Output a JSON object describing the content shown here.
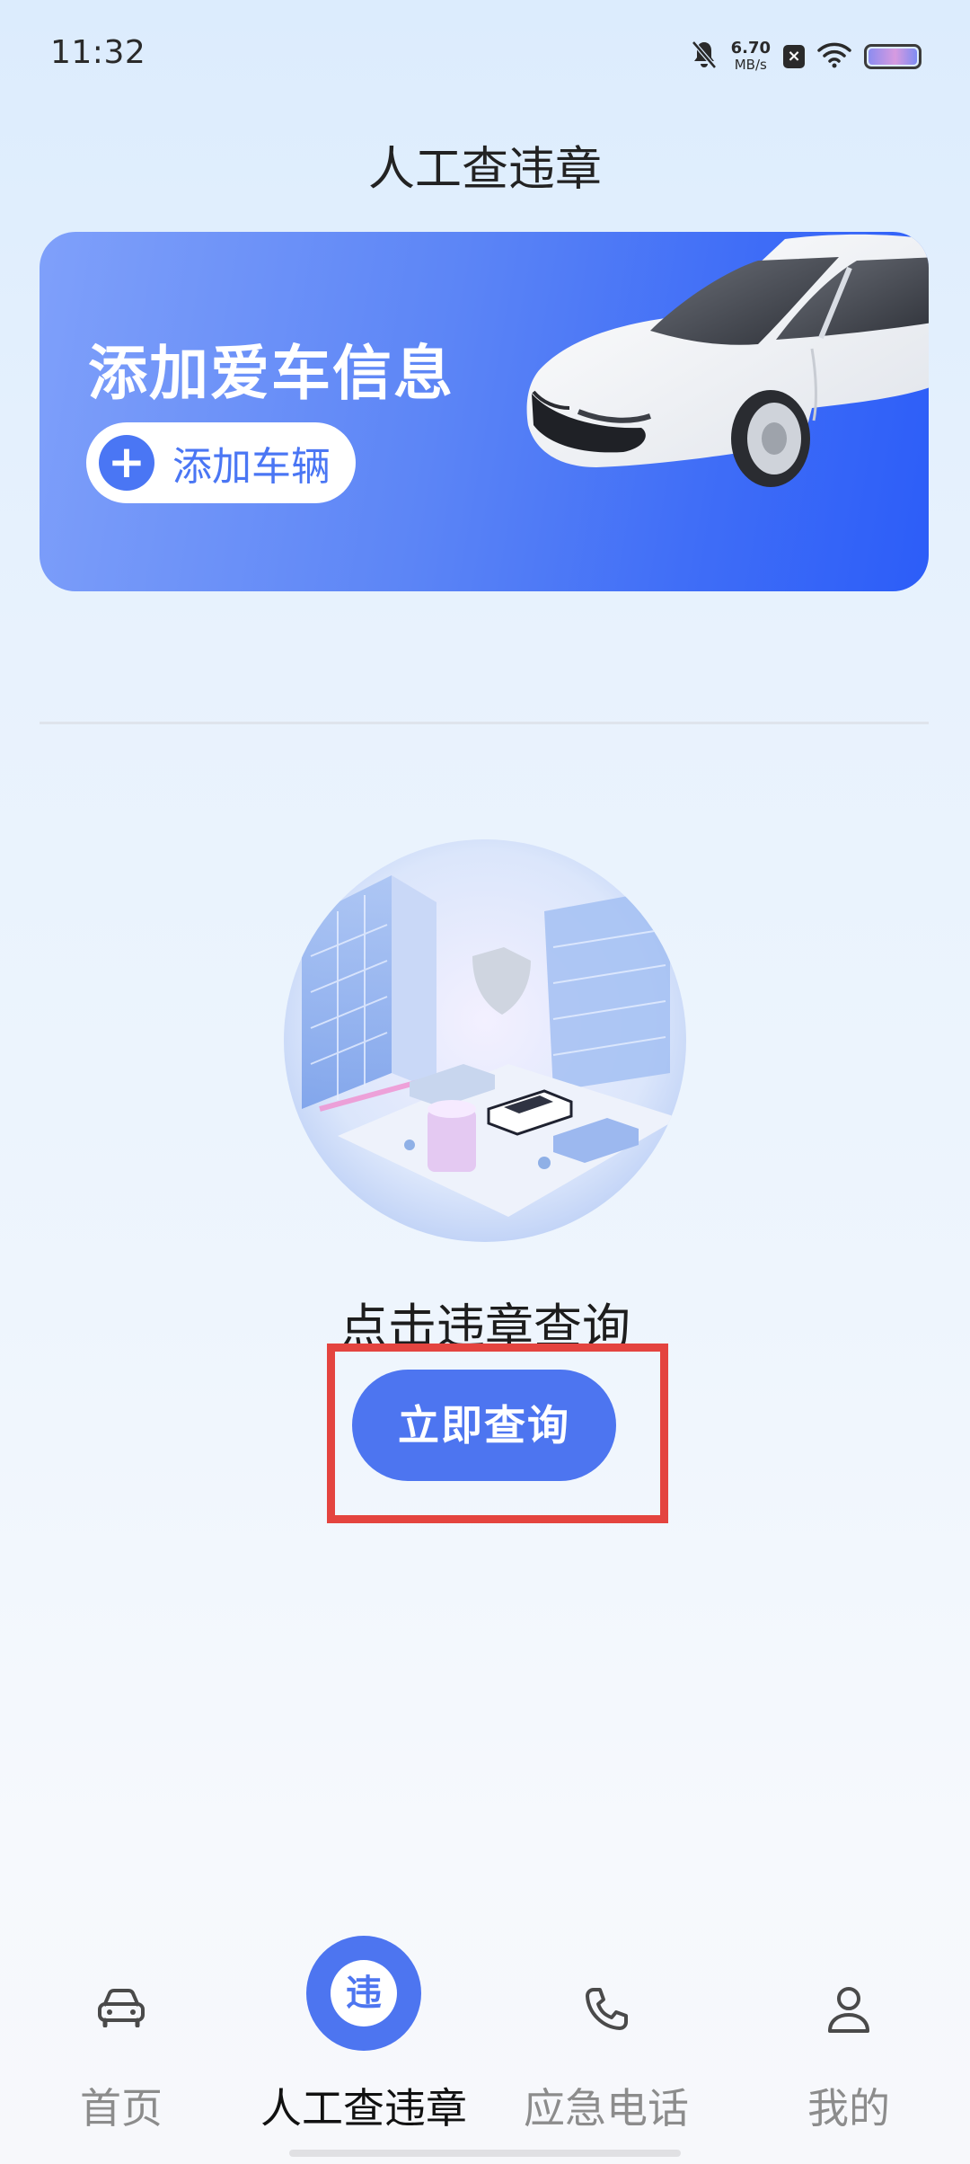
{
  "status_bar": {
    "time": "11:32",
    "net_speed_value": "6.70",
    "net_speed_unit": "MB/s"
  },
  "page": {
    "title": "人工查违章"
  },
  "banner": {
    "title": "添加爱车信息",
    "add_vehicle_label": "添加车辆"
  },
  "query": {
    "prompt": "点击违章查询",
    "button_label": "立即查询"
  },
  "bottom_nav": {
    "active_badge_char": "违",
    "items": [
      {
        "label": "首页",
        "icon": "car-icon",
        "active": false
      },
      {
        "label": "人工查违章",
        "icon": "violation-icon",
        "active": true
      },
      {
        "label": "应急电话",
        "icon": "phone-icon",
        "active": false
      },
      {
        "label": "我的",
        "icon": "user-icon",
        "active": false
      }
    ]
  },
  "colors": {
    "accent": "#4d75f0",
    "highlight": "#e4443f"
  }
}
